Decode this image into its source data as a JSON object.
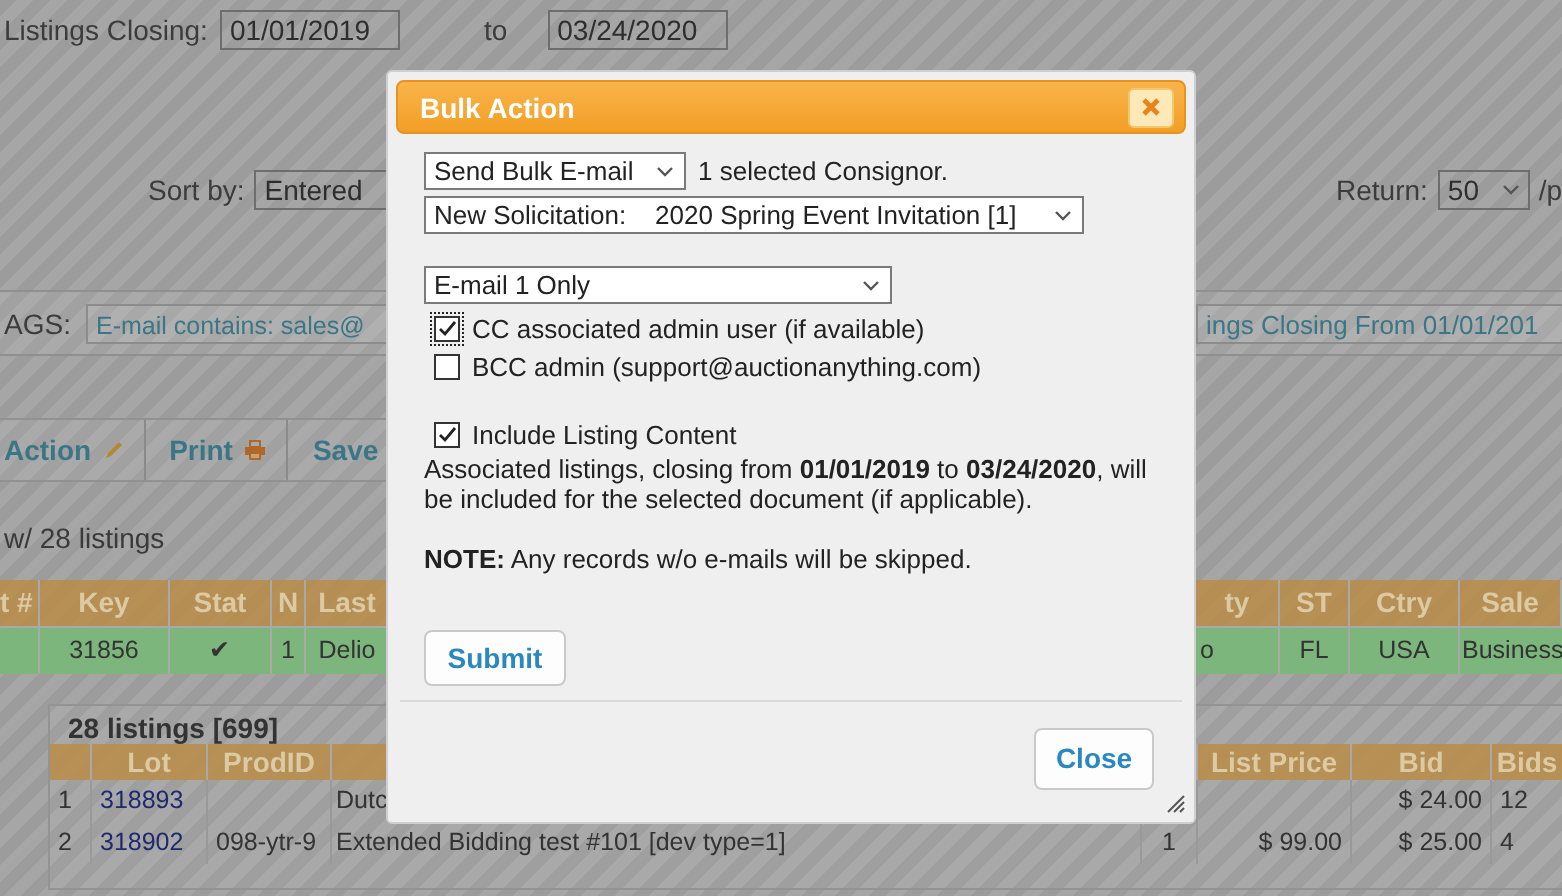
{
  "filters": {
    "closing_label": "Listings Closing:",
    "date_from": "01/01/2019",
    "to_label": "to",
    "date_to": "03/24/2020",
    "sort_label": "Sort by:",
    "sort_value": "Entered",
    "return_label": "Return:",
    "return_value": "50",
    "per_page_label": "/p"
  },
  "tags": {
    "label": "AGS:",
    "items": [
      "E-mail contains: sales@",
      "ings Closing From 01/01/201"
    ]
  },
  "toolbar": [
    "Action",
    "Print",
    "Save"
  ],
  "result_count": "w/ 28 listings",
  "consignors": {
    "columns": [
      "t #",
      "Key",
      "Stat",
      "N",
      "Last",
      "ty",
      "ST",
      "Ctry",
      "Sale"
    ],
    "rows": [
      {
        "selected": true,
        "cells": {
          "key": "31856",
          "stat": "✔",
          "n": "1",
          "last": "Delio",
          "column_6": "o",
          "st": "FL",
          "ctry": "USA",
          "sale": "Business"
        }
      }
    ]
  },
  "listings": {
    "title": "28 listings [699]",
    "columns": {
      "lot": "Lot",
      "prod_id": "ProdID",
      "list_price": "List Price",
      "bid": "Bid",
      "bids": "Bids"
    },
    "rows": [
      {
        "index": "1",
        "lot": "318893",
        "title": "Dutc",
        "bid": "$ 24.00",
        "bids": "12"
      },
      {
        "index": "2",
        "lot": "318902",
        "prod_id": "098-ytr-9",
        "title": "Extended Bidding test #101 [dev type=1]",
        "qty": "1",
        "list_price": "$ 99.00",
        "bid": "$ 25.00",
        "bids": "4"
      }
    ]
  },
  "dialog": {
    "title": "Bulk Action",
    "action_select": "Send Bulk E-mail",
    "selection_note": "1 selected Consignor.",
    "document_select": "New Solicitation:    2020 Spring Event Invitation [1]",
    "email_select": "E-mail 1 Only",
    "options": [
      {
        "label": "CC associated admin user (if available)",
        "checked": true
      },
      {
        "label": "BCC admin (support@auctionanything.com)",
        "checked": false
      }
    ],
    "include": {
      "label": "Include Listing Content",
      "checked": true,
      "description": "Associated listings, closing from **01/01/2019** to **03/24/2020**, will be included for the selected document (if applicable)."
    },
    "note": "**NOTE:** Any records w/o e-mails will be skipped.",
    "submit": "Submit",
    "close": "Close"
  }
}
